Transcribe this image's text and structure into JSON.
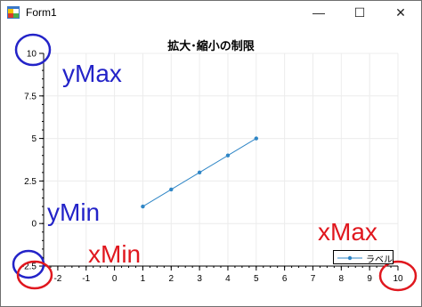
{
  "window": {
    "title": "Form1",
    "controls": {
      "minimize": "—",
      "maximize": "☐",
      "close": "✕"
    }
  },
  "annotations": {
    "ymax": "yMax",
    "ymin": "yMin",
    "xmin": "xMin",
    "xmax": "xMax"
  },
  "colors": {
    "series": "#2f86c6",
    "annotation_blue": "#2323c8",
    "annotation_red": "#e0171e"
  },
  "chart_data": {
    "type": "line",
    "title": "拡大･縮小の制限",
    "xlim": [
      -2.5,
      10
    ],
    "ylim": [
      -2.5,
      10
    ],
    "x_ticks": [
      -2,
      -1,
      0,
      1,
      2,
      3,
      4,
      5,
      6,
      7,
      8,
      9,
      10
    ],
    "y_ticks": [
      -2.5,
      0,
      2.5,
      5,
      7.5,
      10
    ],
    "grid": true,
    "legend_position": "bottom-right",
    "series": [
      {
        "name": "ラベル",
        "x": [
          1,
          2,
          3,
          4,
          5
        ],
        "y": [
          1,
          2,
          3,
          4,
          5
        ]
      }
    ]
  }
}
